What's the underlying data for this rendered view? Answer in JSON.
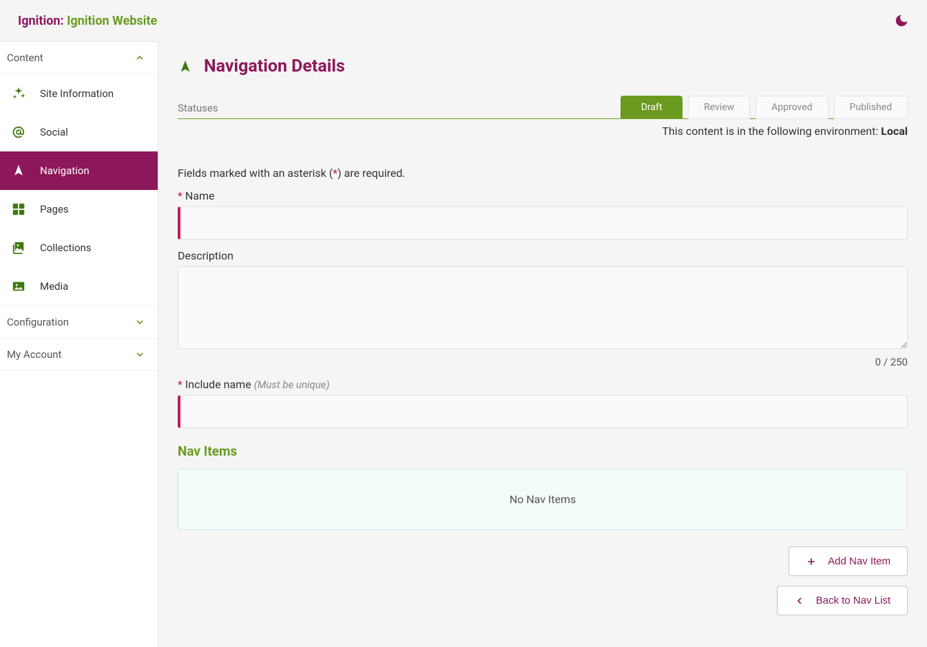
{
  "brand": {
    "prefix": "Ignition: ",
    "suffix": "Ignition Website"
  },
  "sidebar": {
    "groups": [
      {
        "label": "Content",
        "expanded": true,
        "items": [
          {
            "label": "Site Information",
            "icon": "sparkles-icon",
            "active": false
          },
          {
            "label": "Social",
            "icon": "at-icon",
            "active": false
          },
          {
            "label": "Navigation",
            "icon": "pointer-icon",
            "active": true
          },
          {
            "label": "Pages",
            "icon": "pages-icon",
            "active": false
          },
          {
            "label": "Collections",
            "icon": "image-stack-icon",
            "active": false
          },
          {
            "label": "Media",
            "icon": "image-icon",
            "active": false
          }
        ]
      },
      {
        "label": "Configuration",
        "expanded": false,
        "items": []
      },
      {
        "label": "My Account",
        "expanded": false,
        "items": []
      }
    ]
  },
  "page": {
    "title": "Navigation Details",
    "statuses_label": "Statuses",
    "statuses": [
      {
        "label": "Draft",
        "active": true
      },
      {
        "label": "Review",
        "active": false
      },
      {
        "label": "Approved",
        "active": false
      },
      {
        "label": "Published",
        "active": false
      }
    ],
    "environment_prefix": "This content is in the following environment: ",
    "environment_name": "Local",
    "required_note_pre": "Fields marked with an asterisk (",
    "required_note_ast": "*",
    "required_note_post": ") are required.",
    "fields": {
      "name": {
        "label": "Name",
        "required": true,
        "value": ""
      },
      "description": {
        "label": "Description",
        "required": false,
        "value": "",
        "counter": "0 / 250"
      },
      "include_name": {
        "label": "Include name",
        "hint": "(Must be unique)",
        "required": true,
        "value": ""
      }
    },
    "nav_items_title": "Nav Items",
    "nav_items_empty": "No Nav Items",
    "actions": {
      "add": "Add Nav Item",
      "back": "Back to Nav List"
    }
  }
}
